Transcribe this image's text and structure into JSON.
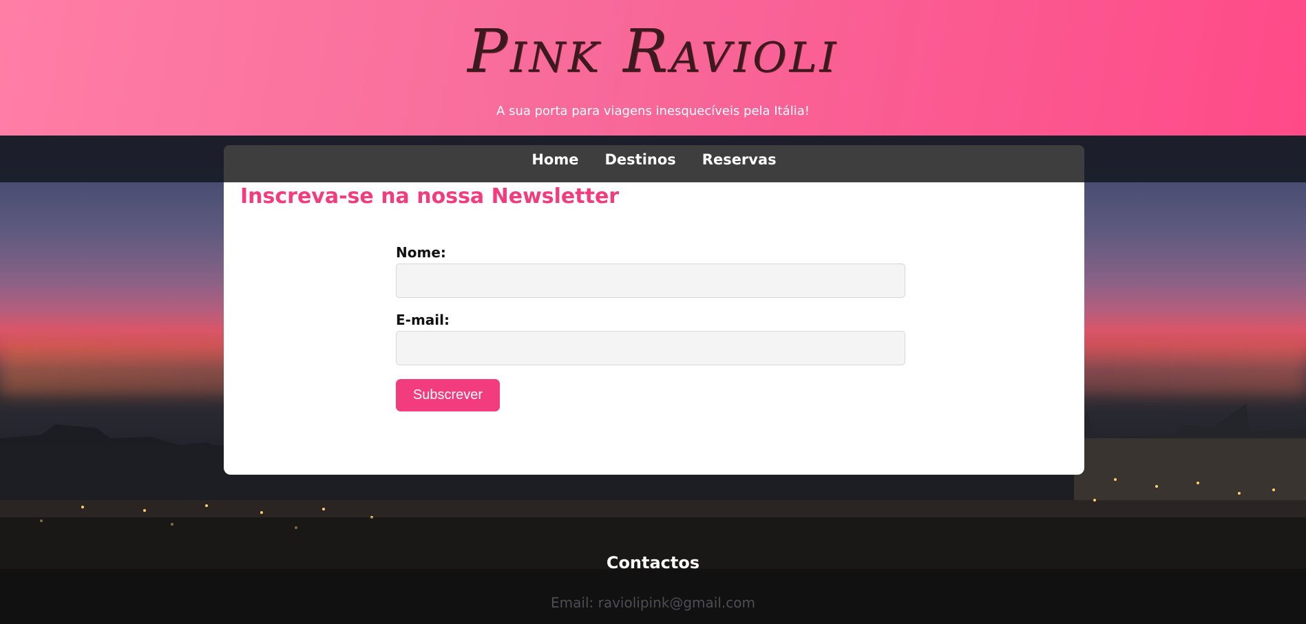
{
  "header": {
    "logo_text": "Pink Ravioli",
    "tagline": "A sua porta para viagens inesquecíveis pela Itália!"
  },
  "nav": {
    "items": [
      {
        "label": "Home"
      },
      {
        "label": "Destinos"
      },
      {
        "label": "Reservas"
      }
    ]
  },
  "newsletter": {
    "title": "Inscreva-se na nossa Newsletter",
    "name_label": "Nome:",
    "name_value": "",
    "email_label": "E-mail:",
    "email_value": "",
    "submit_label": "Subscrever"
  },
  "footer": {
    "title": "Contactos",
    "email_text": "Email: raviolipink@gmail.com"
  },
  "colors": {
    "accent": "#f23c7e",
    "header_start": "#ff7ea6",
    "header_end": "#ff4a88",
    "navbar": "#3e3e3e"
  }
}
